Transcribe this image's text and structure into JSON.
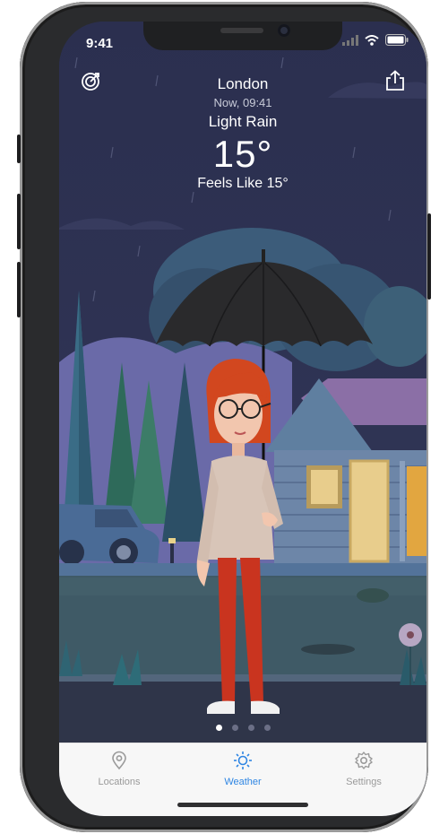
{
  "status": {
    "time": "9:41"
  },
  "weather": {
    "city": "London",
    "time": "Now, 09:41",
    "condition": "Light Rain",
    "temperature": "15°",
    "feels_like": "Feels Like 15°"
  },
  "pager": {
    "pages": 4,
    "active_index": 0
  },
  "tabs": [
    {
      "label": "Locations",
      "icon": "location-pin-icon",
      "active": false
    },
    {
      "label": "Weather",
      "icon": "sun-icon",
      "active": true
    },
    {
      "label": "Settings",
      "icon": "gear-icon",
      "active": false
    }
  ],
  "colors": {
    "sky": "#2b2f4f",
    "accent": "#2f86e3",
    "tab_inactive": "#9a9a9a"
  }
}
